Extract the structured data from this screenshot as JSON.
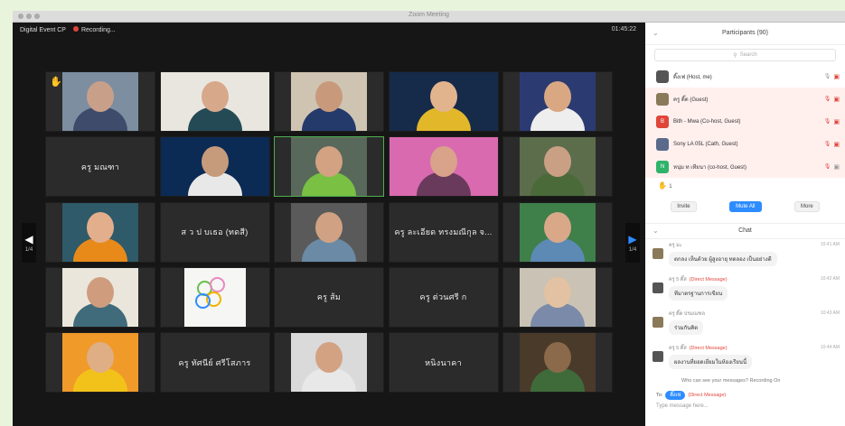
{
  "window": {
    "title": "Zoom Meeting"
  },
  "topbar": {
    "host_label": "Digital Event CP",
    "recording_label": "Recording...",
    "timer": "01:45:22"
  },
  "tiles": [
    {
      "name": "",
      "hand": true,
      "video": true,
      "skin": "#c8a08a",
      "shirt": "#3e4b6b",
      "bg": "#7d8ea0"
    },
    {
      "name": "",
      "video": true,
      "skin": "#d7a88a",
      "shirt": "#244a55",
      "bg": "#e9e6df"
    },
    {
      "name": "",
      "video": true,
      "skin": "#c89a7b",
      "shirt": "#243a6b",
      "bg": "#cfc4b2"
    },
    {
      "name": "",
      "video": true,
      "skin": "#e2b48e",
      "shirt": "#e2b82a",
      "bg": "#162a4a"
    },
    {
      "name": "",
      "video": true,
      "skin": "#d9a882",
      "shirt": "#eeeeee",
      "bg": "#2b3b72"
    },
    {
      "name": "ครู มณฑา",
      "video": false
    },
    {
      "name": "",
      "video": true,
      "skin": "#c59b7c",
      "shirt": "#e8e8e8",
      "bg": "#0b2a54"
    },
    {
      "name": "",
      "video": true,
      "active": true,
      "skin": "#d2a283",
      "shirt": "#79c043",
      "bg": "#58685a"
    },
    {
      "name": "",
      "video": true,
      "skin": "#d9a28a",
      "shirt": "#6a3a5c",
      "bg": "#d96ab0"
    },
    {
      "name": "",
      "video": true,
      "skin": "#caa085",
      "shirt": "#4a6a3a",
      "bg": "#5c6d4c"
    },
    {
      "name": "",
      "video": true,
      "skin": "#e3ae8c",
      "shirt": "#e88a1a",
      "bg": "#2e5a6a"
    },
    {
      "name": "ส ว ป บเธอ (ทดสี)",
      "video": false
    },
    {
      "name": "",
      "video": true,
      "skin": "#d0a283",
      "shirt": "#6b8aa5",
      "bg": "#5a5a5a"
    },
    {
      "name": "ครู ละเอียด ทรงมณีกุล จ...",
      "video": false
    },
    {
      "name": "",
      "video": true,
      "skin": "#d8a888",
      "shirt": "#5c8ab5",
      "bg": "#3f7f4a"
    },
    {
      "name": "",
      "video": true,
      "skin": "#cf9c7e",
      "shirt": "#3f6b7a",
      "bg": "#ebe6dc"
    },
    {
      "name": "",
      "video": false,
      "logo": true
    },
    {
      "name": "ครู ส้ม",
      "video": false
    },
    {
      "name": "ครู ต่วนศรี ก",
      "video": false
    },
    {
      "name": "",
      "video": true,
      "skin": "#e2c2a2",
      "shirt": "#7a8aa8",
      "bg": "#c9c2b5"
    },
    {
      "name": "",
      "video": true,
      "skin": "#e0ae84",
      "shirt": "#f2c21a",
      "bg": "#f09a2a"
    },
    {
      "name": "ครู ทัศนีย์ ศรีโสภาร",
      "video": false
    },
    {
      "name": "",
      "video": true,
      "skin": "#d2a283",
      "shirt": "#e8e8e8",
      "bg": "#dadada"
    },
    {
      "name": "หนิงนาคา",
      "video": false
    },
    {
      "name": "",
      "video": true,
      "skin": "#8a6a4a",
      "shirt": "#3f6b3a",
      "bg": "#4a3a2a"
    }
  ],
  "nav": {
    "left_num": "1/4",
    "right_num": "1/4"
  },
  "participants_panel": {
    "title": "Participants (90)",
    "search_label": "Search",
    "participants": [
      {
        "name": "ติ๊งเฟ (Host, me)",
        "avatar_text": "",
        "avatar_color": "#555555",
        "highlight": false
      },
      {
        "name": "ครู ติ๊ต (Guest)",
        "avatar_text": "",
        "avatar_color": "#8a7a5a",
        "highlight": true
      },
      {
        "name": "Bith - Mwa (Co-host, Guest)",
        "avatar_text": "B",
        "avatar_color": "#e0453a",
        "highlight": true
      },
      {
        "name": "Sony LA 05L (Cath, Guest)",
        "avatar_text": "",
        "avatar_color": "#5a6a8a",
        "highlight": true
      },
      {
        "name": "หนุ่ม ท เทียนา (co-host, Guest)",
        "avatar_text": "N",
        "avatar_color": "#2fb36b",
        "highlight": true
      }
    ],
    "reaction_count": "1",
    "buttons": [
      "Invite",
      "Mute All",
      "More"
    ]
  },
  "chat": {
    "title": "Chat",
    "messages": [
      {
        "from": "ครู มะ",
        "dm": "",
        "text": "ตกลง เห็นด้วย ผู้สูงอายุ ทดลอง เป็นอย่างดี",
        "time": "10:41 AM",
        "avatar_color": "#8a7a5a"
      },
      {
        "from": "ครู 5 ติ๊ส",
        "dm": "(Direct Message)",
        "text": "ทีมาตรฐานการเขียน",
        "time": "10:42 AM",
        "avatar_color": "#555555"
      },
      {
        "from": "ครู ติ๊ต ปรมณฑล",
        "dm": "",
        "text": "ร่วมกันคิด",
        "time": "10:43 AM",
        "avatar_color": "#8a7a5a"
      },
      {
        "from": "ครู 5 ติ๊ส",
        "dm": "(Direct Message)",
        "text": "ผลงานที่ยอดเยี่ยมในห้องเรียนนี้",
        "time": "10:44 AM",
        "avatar_color": "#555555"
      }
    ],
    "recording_note": "Who can see your messages? Recording On",
    "to_label": "To:",
    "to_recipient": "ติ๊งเฟ",
    "to_dm": "(Direct Message)",
    "input_placeholder": "Type message here..."
  }
}
